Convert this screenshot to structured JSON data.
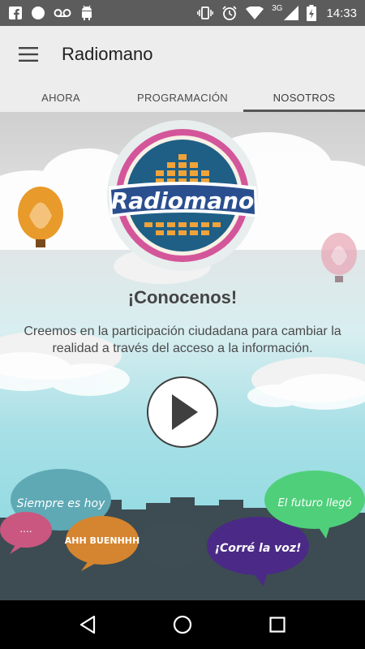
{
  "status_bar": {
    "time": "14:33",
    "network": "3G",
    "left_icons": [
      "facebook-icon",
      "circle-notification-icon",
      "voicemail-icon",
      "android-icon"
    ],
    "right_icons": [
      "vibrate-icon",
      "alarm-icon",
      "wifi-icon",
      "signal-icon",
      "battery-charging-icon"
    ]
  },
  "app_bar": {
    "title": "Radiomano",
    "menu_icon": "hamburger-menu-icon"
  },
  "tabs": [
    {
      "label": "AHORA",
      "active": false
    },
    {
      "label": "PROGRAMACIÓN",
      "active": false
    },
    {
      "label": "NOSOTROS",
      "active": true
    }
  ],
  "main": {
    "logo_text": "Radiomano",
    "heading": "¡Conocenos!",
    "description": "Creemos en la participación ciudadana para cambiar la realidad a través del acceso a la información.",
    "play_icon": "play-icon"
  },
  "bubbles": [
    {
      "text": "Siempre es hoy",
      "color": "#5fa9b5"
    },
    {
      "text": "....",
      "color": "#c9577f"
    },
    {
      "text": "AHH BUENHHH",
      "color": "#d5852f"
    },
    {
      "text": "¡Corré la voz!",
      "color": "#4a2a86"
    },
    {
      "text": "El futuro llegó",
      "color": "#4fcf7a"
    }
  ],
  "nav_bar": {
    "icons": [
      "back-icon",
      "home-icon",
      "recents-icon"
    ]
  },
  "colors": {
    "status_bar": "#5c5c5c",
    "app_bar": "#ededed",
    "logo_ring_pink": "#d4569a",
    "logo_blue": "#1f5f86",
    "equalizer_orange": "#f0a33a"
  }
}
